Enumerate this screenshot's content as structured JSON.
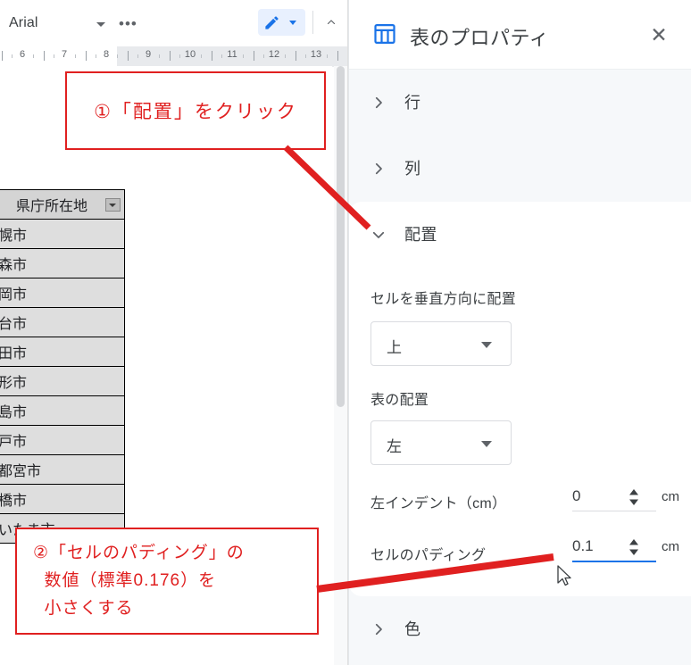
{
  "toolbar": {
    "font_name": "Arial",
    "more_label": "•••",
    "pen_icon": "pencil-icon",
    "pen_dropdown_icon": "chevron-down-icon",
    "collapse_icon": "chevron-up-icon"
  },
  "ruler": {
    "numbers": [
      6,
      7,
      8,
      9,
      10,
      11,
      12,
      13
    ],
    "margin_end": 8
  },
  "document": {
    "table": {
      "header": "県庁所在地",
      "header_filter_icon": "filter-dropdown-icon",
      "rows": [
        "札幌市",
        "青森市",
        "盛岡市",
        "仙台市",
        "秋田市",
        "山形市",
        "福島市",
        "水戸市",
        "宇都宮市",
        "前橋市",
        "さいたま市"
      ]
    }
  },
  "callouts": [
    {
      "id": "callout-1",
      "text": "①「配置」をクリック",
      "color": "#e02020"
    },
    {
      "id": "callout-2",
      "text": "②「セルのパディング」の\n  数値（標準0.176）を\n  小さくする",
      "color": "#e02020"
    }
  ],
  "panel": {
    "icon": "table-icon",
    "icon_color": "#1a73e8",
    "title": "表のプロパティ",
    "close_label": "✕",
    "sections": [
      {
        "label": "行",
        "expanded": false,
        "chevron": "chevron-right-icon"
      },
      {
        "label": "列",
        "expanded": false,
        "chevron": "chevron-right-icon"
      },
      {
        "label": "配置",
        "expanded": true,
        "chevron": "chevron-down-icon"
      },
      {
        "label": "色",
        "expanded": false,
        "chevron": "chevron-right-icon"
      }
    ],
    "align_section": {
      "cell_vertical_label": "セルを垂直方向に配置",
      "cell_vertical_value": "上",
      "table_align_label": "表の配置",
      "table_align_value": "左",
      "left_indent_label": "左インデント（cm）",
      "left_indent_value": "0",
      "left_indent_unit": "cm",
      "cell_padding_label": "セルのパディング",
      "cell_padding_value": "0.1",
      "cell_padding_unit": "cm",
      "focus_color": "#1a73e8"
    }
  },
  "cursor": {
    "icon": "mouse-pointer-icon"
  }
}
